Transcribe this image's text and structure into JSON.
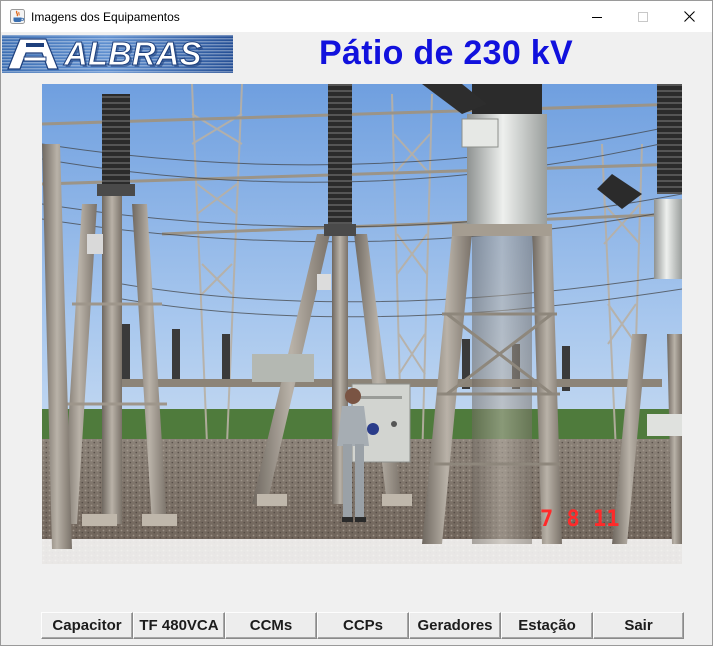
{
  "window": {
    "title": "Imagens dos Equipamentos",
    "controls": {
      "minimize": "minimize-icon",
      "maximize": "maximize-icon",
      "close": "close-icon"
    }
  },
  "header": {
    "logo_text": "ALBRAS",
    "title": "Pátio de 230 kV",
    "title_color": "#1111dd"
  },
  "photo": {
    "date_stamp": "7  8 11",
    "stamp_color": "#ff2a2a"
  },
  "buttons": [
    {
      "label": "Capacitor"
    },
    {
      "label": "TF 480VCA"
    },
    {
      "label": "CCMs"
    },
    {
      "label": "CCPs"
    },
    {
      "label": "Geradores"
    },
    {
      "label": "Estação"
    },
    {
      "label": "Sair"
    }
  ]
}
